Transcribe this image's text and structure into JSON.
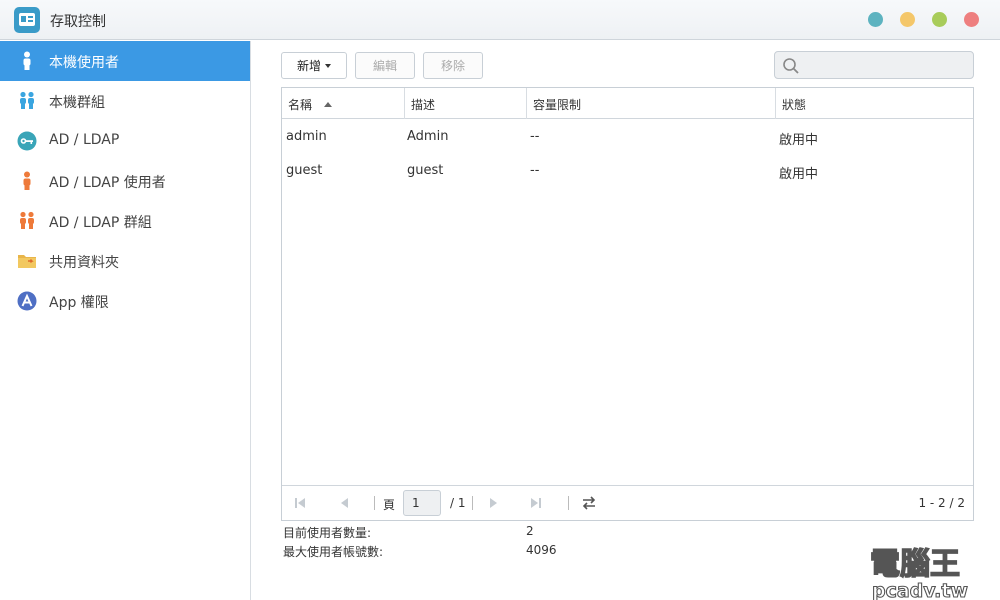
{
  "window": {
    "title": "存取控制",
    "controls": [
      {
        "name": "restore",
        "color": "#5db3c0"
      },
      {
        "name": "minimize",
        "color": "#f4c76a"
      },
      {
        "name": "maximize",
        "color": "#a8cc5a"
      },
      {
        "name": "close",
        "color": "#ee7f7f"
      }
    ]
  },
  "sidebar": {
    "items": [
      {
        "label": "本機使用者",
        "icon": "user-icon",
        "active": true
      },
      {
        "label": "本機群組",
        "icon": "group-icon"
      },
      {
        "label": "AD / LDAP",
        "icon": "key-icon"
      },
      {
        "label": "AD / LDAP 使用者",
        "icon": "user-icon"
      },
      {
        "label": "AD / LDAP 群組",
        "icon": "group-icon"
      },
      {
        "label": "共用資料夾",
        "icon": "folder-icon"
      },
      {
        "label": "App 權限",
        "icon": "app-icon"
      }
    ],
    "accent": "#3b99e4"
  },
  "toolbar": {
    "add_label": "新增",
    "edit_label": "編輯",
    "remove_label": "移除"
  },
  "search": {
    "placeholder": "",
    "value": ""
  },
  "table": {
    "columns": [
      "名稱",
      "描述",
      "容量限制",
      "狀態"
    ],
    "rows": [
      {
        "name": "admin",
        "description": "Admin",
        "quota": "--",
        "status": "啟用中"
      },
      {
        "name": "guest",
        "description": "guest",
        "quota": "--",
        "status": "啟用中"
      }
    ]
  },
  "pager": {
    "page_label": "頁",
    "current_page": "1",
    "total_pages": "/ 1",
    "range": "1 - 2 / 2"
  },
  "stats": {
    "current_users_label": "目前使用者數量:",
    "current_users_value": "2",
    "max_users_label": "最大使用者帳號數:",
    "max_users_value": "4096"
  },
  "watermark": {
    "line1": "電腦王",
    "line2": "pcadv.tw"
  }
}
